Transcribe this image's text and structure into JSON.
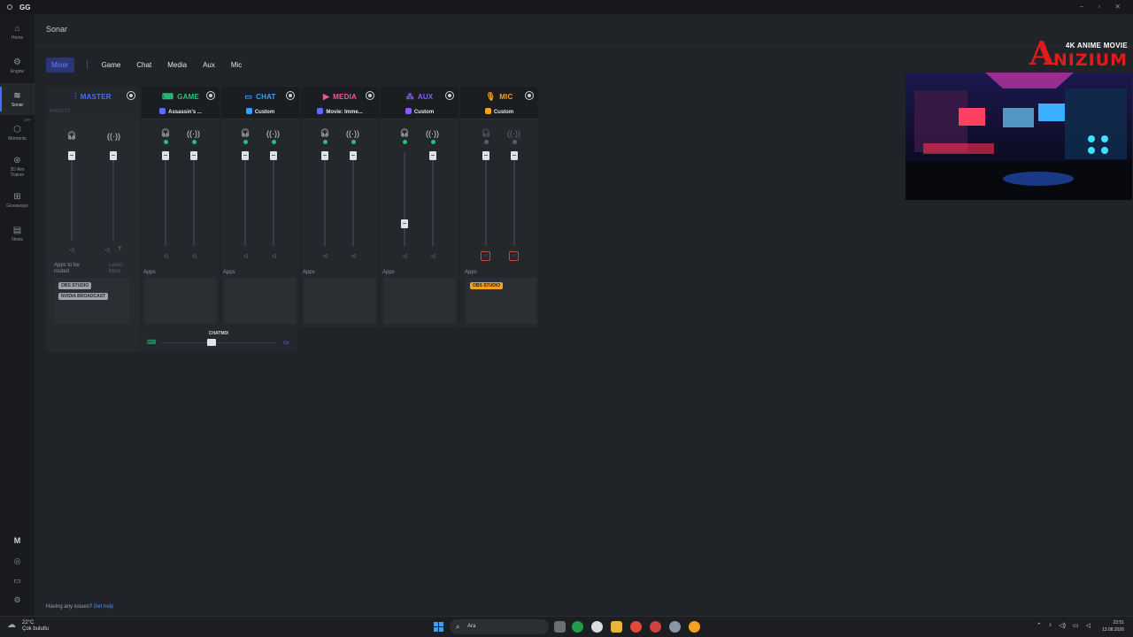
{
  "window": {
    "title": "GG",
    "controls": [
      "–",
      "▫",
      "✕"
    ]
  },
  "sidebar": {
    "items": [
      {
        "label": "Home",
        "icon": "home-icon",
        "glyph": "⌂"
      },
      {
        "label": "Engine",
        "icon": "engine-icon",
        "glyph": "⚙"
      },
      {
        "label": "Sonar",
        "icon": "sonar-icon",
        "glyph": "≋"
      },
      {
        "label": "Moments",
        "icon": "moments-icon",
        "glyph": "⬡",
        "tag": "OFF"
      },
      {
        "label": "3D Aim Trainer",
        "icon": "aim-icon",
        "glyph": "⊛"
      },
      {
        "label": "Giveaways",
        "icon": "gift-icon",
        "glyph": "⊞"
      },
      {
        "label": "News",
        "icon": "news-icon",
        "glyph": "▤"
      }
    ],
    "bottom": {
      "avatar": "M",
      "discord": "◎",
      "chat": "▭",
      "settings": "⚙"
    }
  },
  "header": {
    "title": "Sonar"
  },
  "tabs": [
    {
      "label": "Mixer",
      "active": true
    },
    {
      "label": "Game"
    },
    {
      "label": "Chat"
    },
    {
      "label": "Media"
    },
    {
      "label": "Aux"
    },
    {
      "label": "Mic"
    }
  ],
  "master": {
    "title": "MASTER",
    "presets_label": "PRESETS",
    "apps_to_be_routed": "Apps to be routed",
    "learn_more": "Learn More",
    "chips": [
      "OBS STUDIO",
      "NVIDIA BROADCAST"
    ],
    "color": "#4a6cff"
  },
  "channels": [
    {
      "key": "game",
      "title": "GAME",
      "color": "#21c37a",
      "preset": "Assassin's ...",
      "preset_color": "#5b6cff",
      "apps_label": "Apps",
      "level_hp": 1.0,
      "level_bc": 1.0
    },
    {
      "key": "chat",
      "title": "CHAT",
      "color": "#3aa0ff",
      "preset": "Custom",
      "preset_color": "#3aa0ff",
      "apps_label": "Apps",
      "level_hp": 1.0,
      "level_bc": 1.0
    },
    {
      "key": "media",
      "title": "MEDIA",
      "color": "#ff4fa0",
      "preset": "Movie: Imme...",
      "preset_color": "#5b6cff",
      "apps_label": "Apps",
      "level_hp": 1.0,
      "level_bc": 1.0
    },
    {
      "key": "aux",
      "title": "AUX",
      "color": "#8a5cff",
      "preset": "Custom",
      "preset_color": "#8a5cff",
      "apps_label": "Apps",
      "level_hp": 0.25,
      "level_bc": 1.0
    },
    {
      "key": "mic",
      "title": "MIC",
      "color": "#f3a21b",
      "preset": "Custom",
      "preset_color": "#f3a21b",
      "apps_label": "Apps",
      "chip": "OBS STUDIO",
      "level_hp": 1.0,
      "level_bc": 1.0,
      "muted": true
    }
  ],
  "chatmix": {
    "label": "CHATMIX",
    "balance": 0.5
  },
  "help": {
    "text": "Having any issues?",
    "link": "Get help"
  },
  "watermark": {
    "small": "4K ANIME MOVIE",
    "big": "NIZIUM",
    "letter": "A"
  },
  "taskbar": {
    "temp": "22°C",
    "weather": "Çok bulutlu",
    "search_placeholder": "Ara",
    "time": "22:51",
    "date": "13.08.2026"
  }
}
